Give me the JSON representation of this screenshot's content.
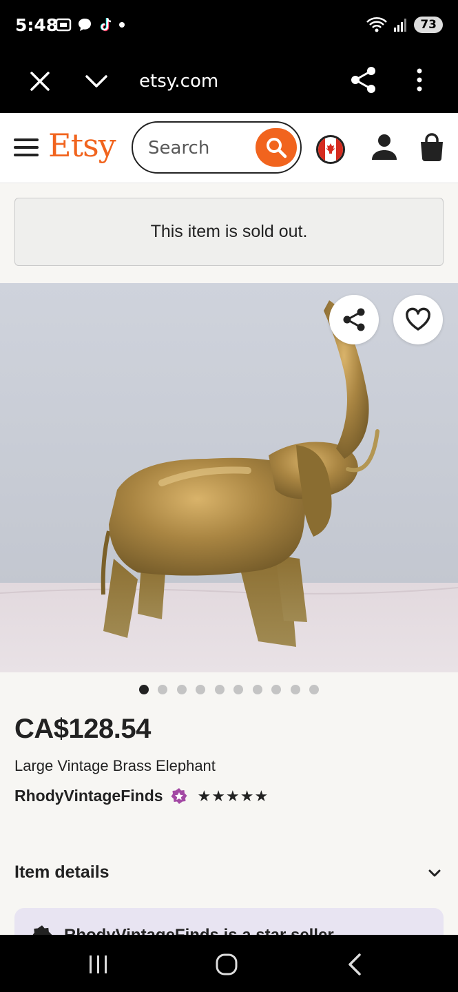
{
  "status_bar": {
    "time": "5:48",
    "battery": "73"
  },
  "browser": {
    "url": "etsy.com"
  },
  "header": {
    "logo": "Etsy",
    "search_placeholder": "Search"
  },
  "notice": {
    "text": "This item is sold out."
  },
  "carousel": {
    "total": 10,
    "active": 0
  },
  "listing": {
    "price": "CA$128.54",
    "title": "Large Vintage Brass Elephant",
    "shop": "RhodyVintageFinds",
    "rating_stars": "★★★★★",
    "rating": 5
  },
  "details": {
    "label": "Item details"
  },
  "star_seller": {
    "text": "RhodyVintageFinds is a star seller"
  },
  "colors": {
    "brand": "#f1641e",
    "star_seller_bg": "#e8e4f2",
    "star_seller_badge": "#a349a4"
  }
}
